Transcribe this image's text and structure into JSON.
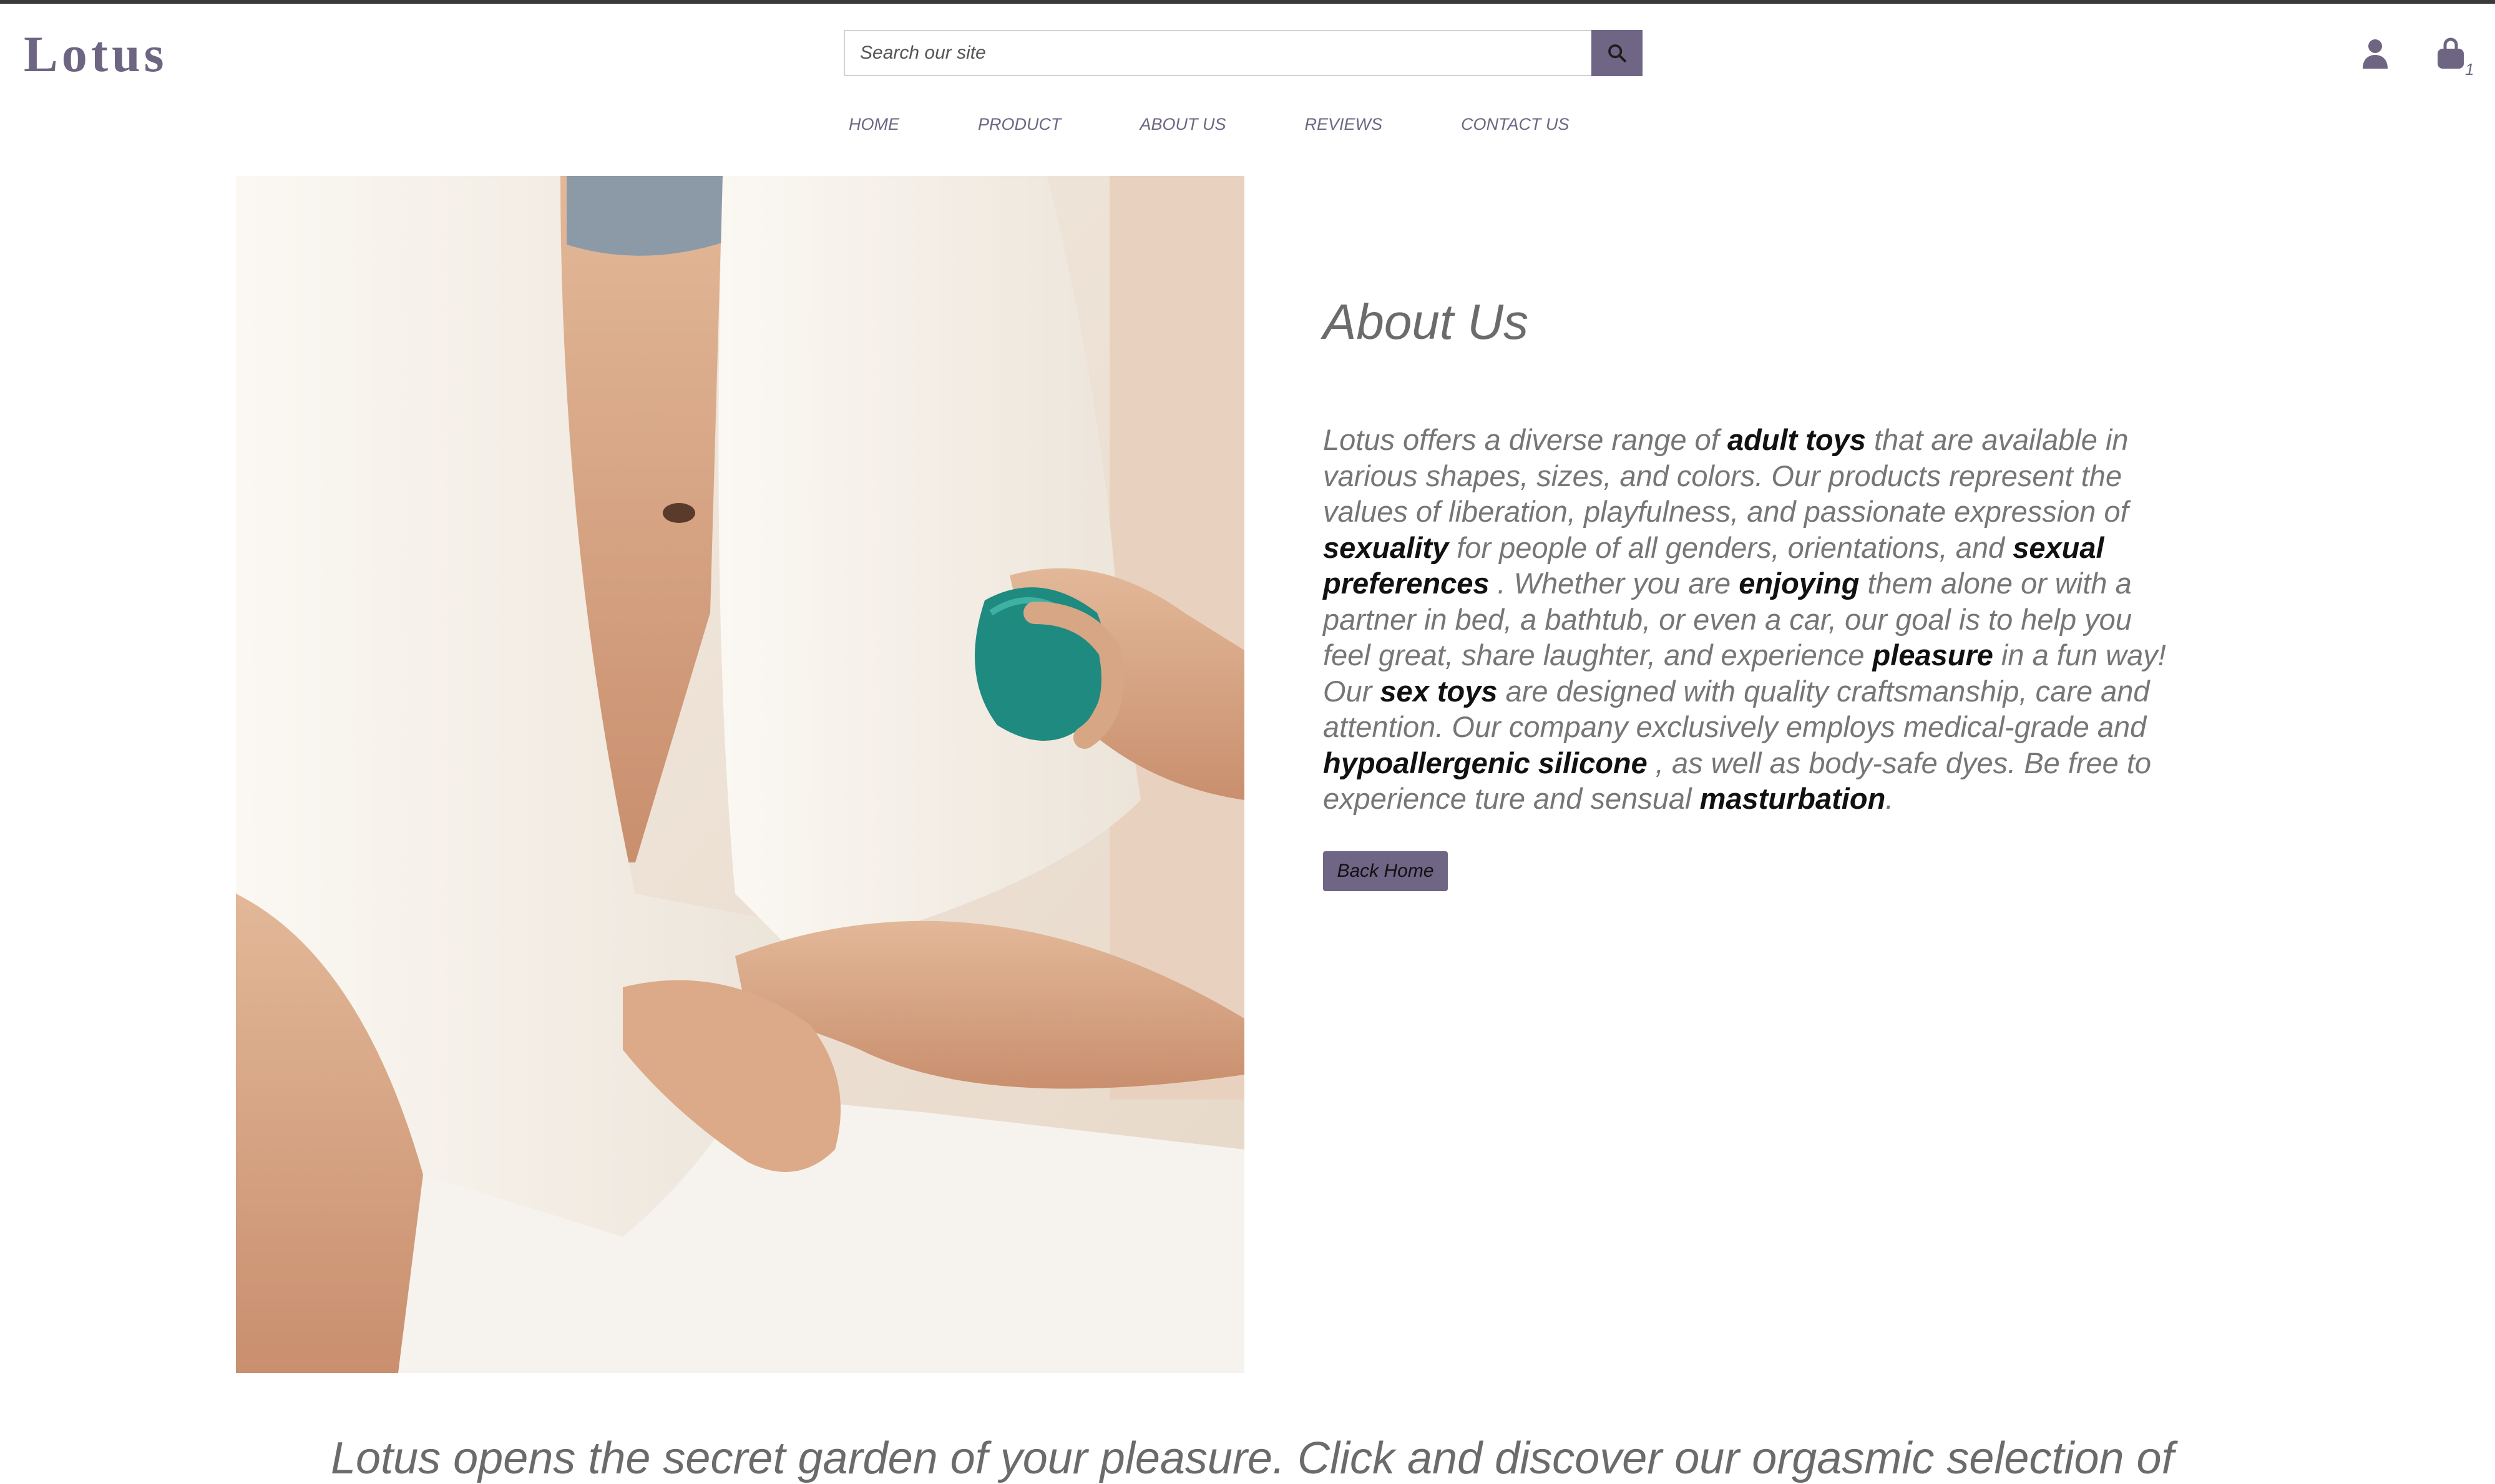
{
  "header": {
    "logo": "Lotus",
    "search_placeholder": "Search our site",
    "cart_count": "1"
  },
  "nav": {
    "items": [
      "HOME",
      "PRODUCT",
      "ABOUT US",
      "REVIEWS",
      "CONTACT US"
    ]
  },
  "about": {
    "title": "About Us",
    "segments": [
      {
        "text": "Lotus offers a diverse range of ",
        "bold": false
      },
      {
        "text": "adult toys",
        "bold": true
      },
      {
        "text": " that are available in various shapes, sizes, and colors. Our products represent the values of liberation, playfulness, and passionate expression of ",
        "bold": false
      },
      {
        "text": "sexuality",
        "bold": true
      },
      {
        "text": " for people of all genders, orientations, and ",
        "bold": false
      },
      {
        "text": "sexual preferences",
        "bold": true
      },
      {
        "text": " . Whether you are ",
        "bold": false
      },
      {
        "text": "enjoying",
        "bold": true
      },
      {
        "text": " them alone or with a partner in bed, a bathtub, or even a car, our goal is to help you feel great, share laughter, and experience ",
        "bold": false
      },
      {
        "text": "pleasure",
        "bold": true
      },
      {
        "text": " in a fun way! Our ",
        "bold": false
      },
      {
        "text": "sex toys",
        "bold": true
      },
      {
        "text": " are designed with quality craftsmanship, care and attention. Our company exclusively employs medical-grade and ",
        "bold": false
      },
      {
        "text": "hypoallergenic silicone",
        "bold": true
      },
      {
        "text": " , as well as body-safe dyes. Be free to experience ture and sensual ",
        "bold": false
      },
      {
        "text": "masturbation",
        "bold": true
      },
      {
        "text": ".",
        "bold": false
      }
    ],
    "button": "Back Home"
  },
  "tagline": "Lotus opens the secret garden of your pleasure. Click and discover our orgasmic selection of",
  "colors": {
    "accent": "#6f6585",
    "text": "#767676",
    "brand": "#6e6582"
  },
  "icons": {
    "search": "search-icon",
    "account": "account-icon",
    "cart": "cart-icon"
  }
}
